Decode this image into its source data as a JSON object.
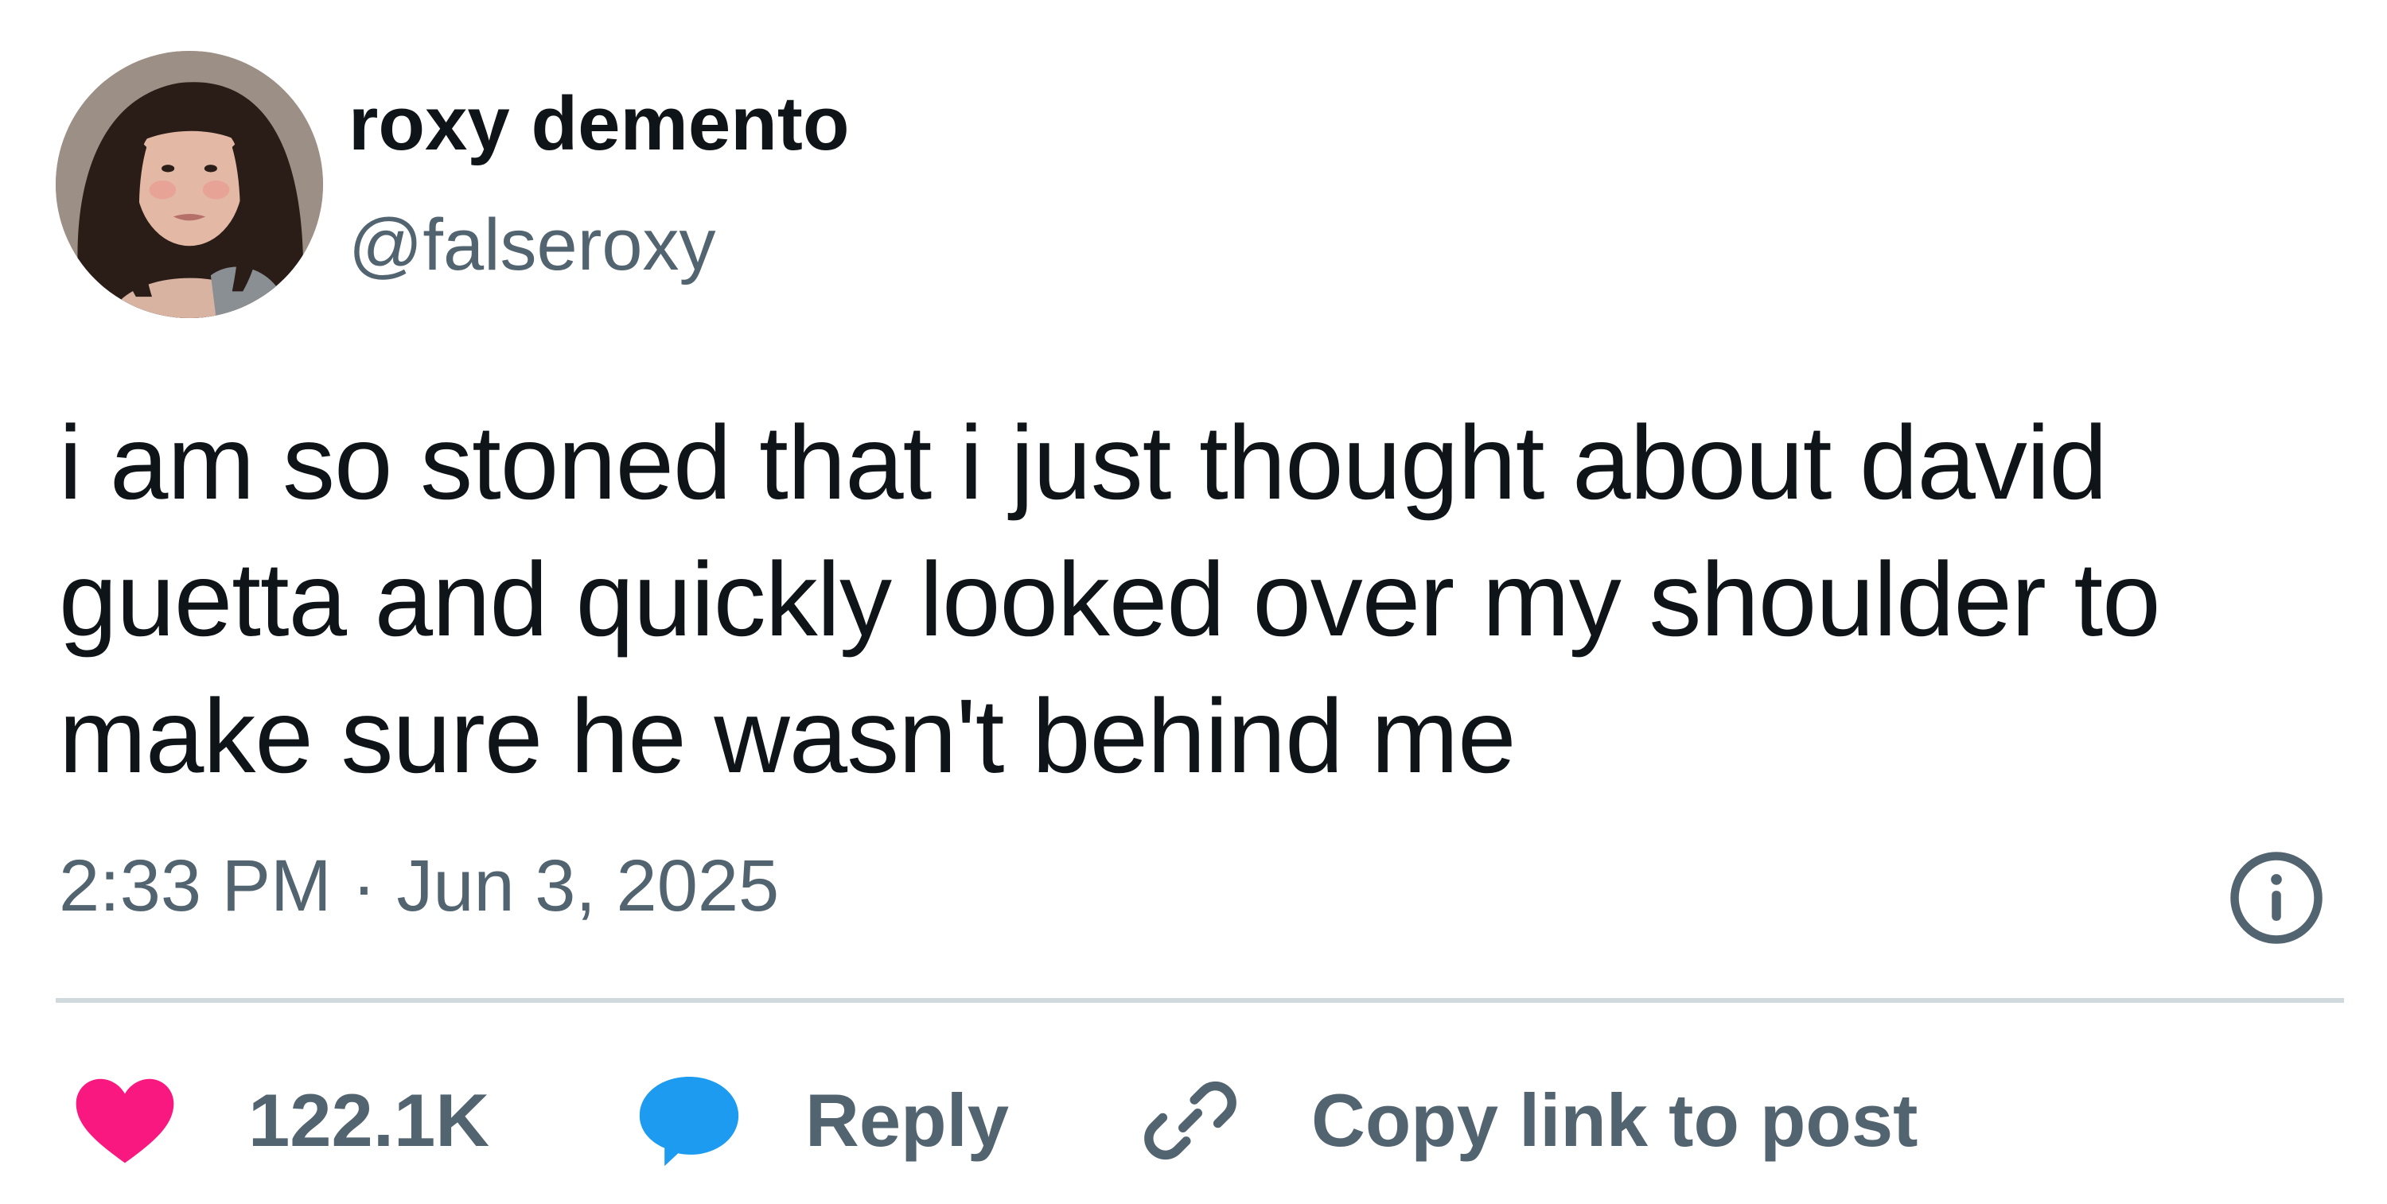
{
  "author": {
    "display_name": "roxy demento",
    "handle": "@falseroxy"
  },
  "tweet": {
    "text": "i am so stoned that i just thought about david\nguetta and quickly looked over my shoulder to\nmake sure he wasn't behind me",
    "timestamp": "2:33 PM · Jun 3, 2025"
  },
  "actions": {
    "like_count": "122.1K",
    "reply_label": "Reply",
    "copy_link_label": "Copy link to post"
  },
  "icons": {
    "like": "heart-icon",
    "reply": "chat-bubble-icon",
    "copy": "link-icon",
    "info": "info-icon"
  },
  "colors": {
    "text_primary": "#0f1419",
    "text_secondary": "#536471",
    "like": "#f91880",
    "reply": "#1d9bf0",
    "divider": "#cfd9de"
  }
}
